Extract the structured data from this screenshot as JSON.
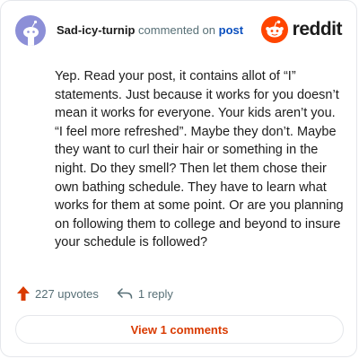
{
  "comment": {
    "username": "Sad-icy-turnip",
    "action_text": " commented on ",
    "target_link": "post",
    "body": "Yep. Read your post, it contains allot of “I” statements. Just because it works for you doesn’t mean it works for everyone. Your kids aren’t you. “I feel more refreshed”. Maybe they don’t. Maybe they want to curl their hair or something in the night. Do they smell? Then let them chose their own bathing schedule. They have to learn what works for them at some point. Or are you planning on following them to college and beyond to insure your schedule is followed?"
  },
  "brand": {
    "name": "reddit",
    "accent_color": "#ff4500"
  },
  "actions": {
    "upvotes": "227 upvotes",
    "replies": "1 reply",
    "upvote_icon": "upvote-arrow-icon",
    "reply_icon": "reply-arrow-icon"
  },
  "footer": {
    "view_comments_label": "View 1 comments"
  },
  "colors": {
    "upvote": "#d93a00",
    "link": "#0a4fbf",
    "muted_text": "#576f76"
  }
}
